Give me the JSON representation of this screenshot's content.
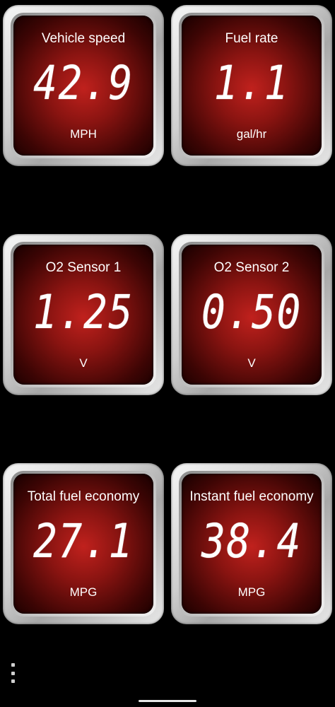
{
  "gauges": [
    {
      "title": "Vehicle speed",
      "value": "42.9",
      "unit": "MPH"
    },
    {
      "title": "Fuel rate",
      "value": "1.1",
      "unit": "gal/hr"
    },
    {
      "title": "O2 Sensor 1",
      "value": "1.25",
      "unit": "V"
    },
    {
      "title": "O2 Sensor 2",
      "value": "0.50",
      "unit": "V"
    },
    {
      "title": "Total fuel economy",
      "value": "27.1",
      "unit": "MPG"
    },
    {
      "title": "Instant fuel economy",
      "value": "38.4",
      "unit": "MPG"
    }
  ],
  "menu": {
    "icon": "more-vertical-icon"
  },
  "colors": {
    "background": "#000000",
    "gauge_face": "#c0211d",
    "text": "#ffffff"
  }
}
